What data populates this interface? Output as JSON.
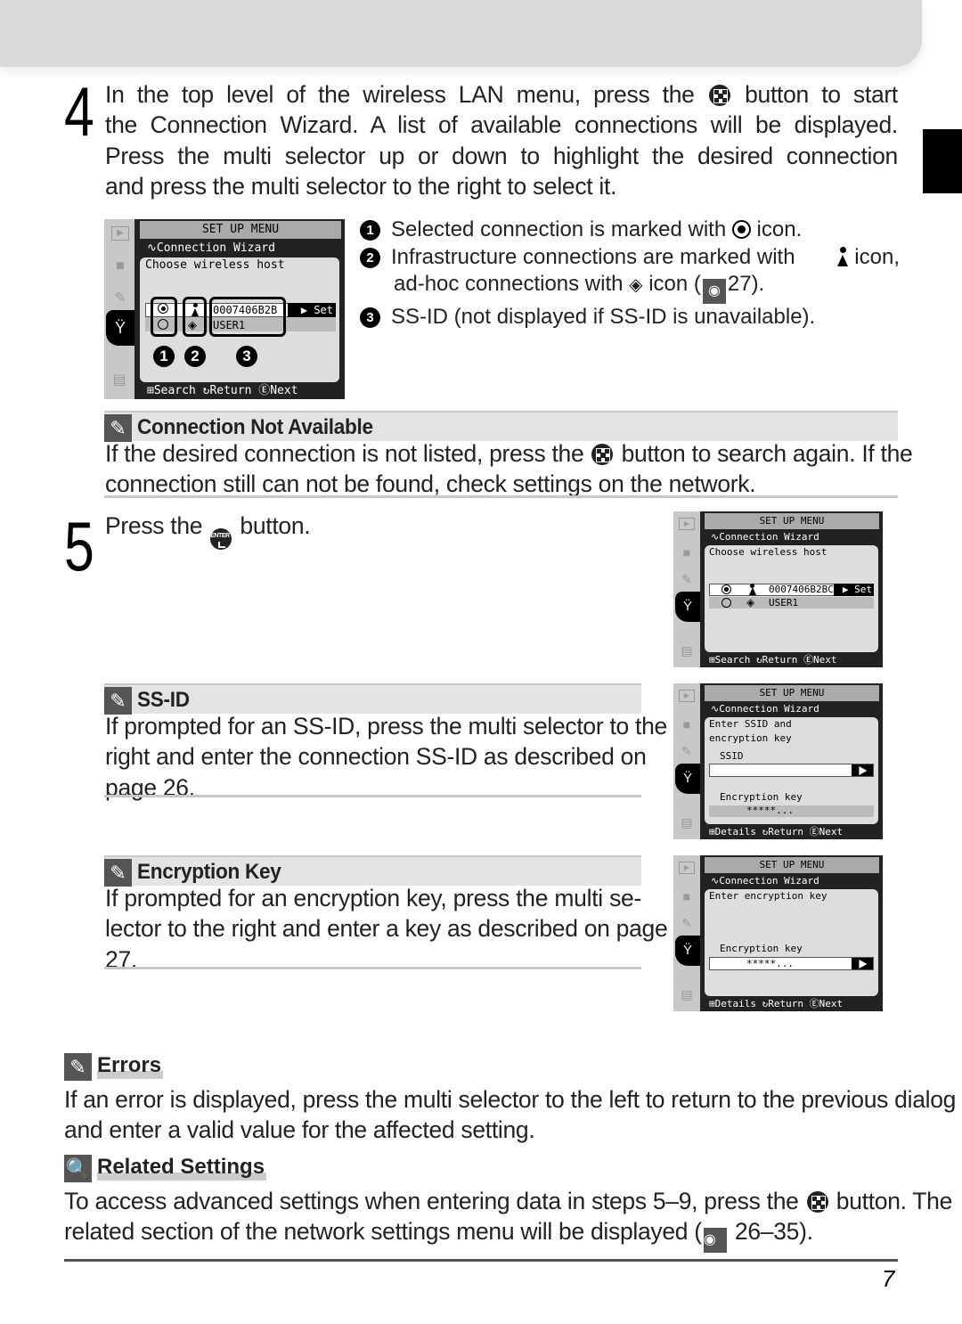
{
  "step4": {
    "number": "4",
    "lines": [
      [
        "In the top level of the wireless LAN menu, press the ",
        "multi-selector-button",
        " button to start"
      ],
      [
        "the Connection Wizard.  A list of available connections will be displayed."
      ],
      [
        "Press the multi selector up or down to highlight the desired connection"
      ],
      [
        "and press the multi selector to the right to select it."
      ]
    ],
    "l1a": "In the top level of the wireless LAN menu, press the",
    "l1b": "button to start",
    "l2": "the Connection Wizard.  A list of available connections will be displayed.",
    "l3": "Press the multi selector up or down to highlight the desired connection",
    "l4": "and press the multi selector to the right to select it."
  },
  "screen1": {
    "title": "SET UP MENU",
    "subtitle": "Connection Wizard",
    "prompt": "Choose wireless host",
    "row1_ssid": "0007406B2B",
    "row2_ssid": "USER1",
    "set_label": "▶ Set",
    "footer": "⊞Search ↻Return ⒾNext",
    "footer_search": "Search",
    "footer_return": "Return",
    "footer_next": "Next",
    "callouts": [
      "1",
      "2",
      "3"
    ]
  },
  "legend": {
    "items": [
      {
        "num": "1",
        "a": "Selected connection is marked with",
        "b": "icon."
      },
      {
        "num": "2",
        "a": "Infrastructure connections are marked with",
        "b": "icon,"
      },
      {
        "num": "",
        "a": "ad-hoc connections with",
        "b": "icon (",
        "c": "27)."
      },
      {
        "num": "3",
        "a": "SS-ID (not displayed if SS-ID is unavailable)."
      }
    ]
  },
  "note_conn": {
    "title": "Connection Not Available",
    "l1a": "If the desired connection is not listed, press the",
    "l1b": "button to search again.  If the",
    "l2": "connection still can not be found, check settings on the network."
  },
  "step5": {
    "number": "5",
    "a": "Press the",
    "enter_label": "ENTER",
    "b": "button."
  },
  "screen2": {
    "title": "SET UP MENU",
    "subtitle": "Connection Wizard",
    "prompt": "Choose wireless host",
    "row1_ssid": "0007406B2BC",
    "row2_ssid": "USER1",
    "set_label": "▶ Set",
    "footer_search": "Search",
    "footer_return": "Return",
    "footer_next": "Next"
  },
  "note_ssid": {
    "title": "SS-ID",
    "l1": "If prompted for an SS-ID, press the multi selector to the",
    "l2": "right and enter the connection SS-ID as described on",
    "l3": "page 26."
  },
  "screen3": {
    "title": "SET UP MENU",
    "subtitle": "Connection Wizard",
    "prompt1": "Enter SSID and",
    "prompt2": "encryption key",
    "ssid_label": "SSID",
    "ssid_value": "",
    "enc_label": "Encryption key",
    "enc_value": "*****...",
    "footer_details": "Details",
    "footer_return": "Return",
    "footer_next": "Next"
  },
  "note_enc": {
    "title": "Encryption Key",
    "l1": "If prompted for an encryption key, press the multi se-",
    "l2": "lector to the right and enter a key as described on page",
    "l3": "27."
  },
  "screen4": {
    "title": "SET UP MENU",
    "subtitle": "Connection Wizard",
    "prompt": "Enter encryption key",
    "enc_label": "Encryption key",
    "enc_value": "*****...",
    "footer_details": "Details",
    "footer_return": "Return",
    "footer_next": "Next"
  },
  "errors": {
    "title": "Errors",
    "l1": "If an error is displayed, press the multi selector to the left to return to the previous dialog",
    "l2": "and enter a valid value for the affected setting."
  },
  "related": {
    "title": "Related Settings",
    "l1a": "To access advanced settings when entering data in steps 5–9, press the",
    "l1b": "button.  The",
    "l2a": "related section of the network settings menu will be displayed (",
    "l2b": "26–35)."
  },
  "page_number": "7"
}
